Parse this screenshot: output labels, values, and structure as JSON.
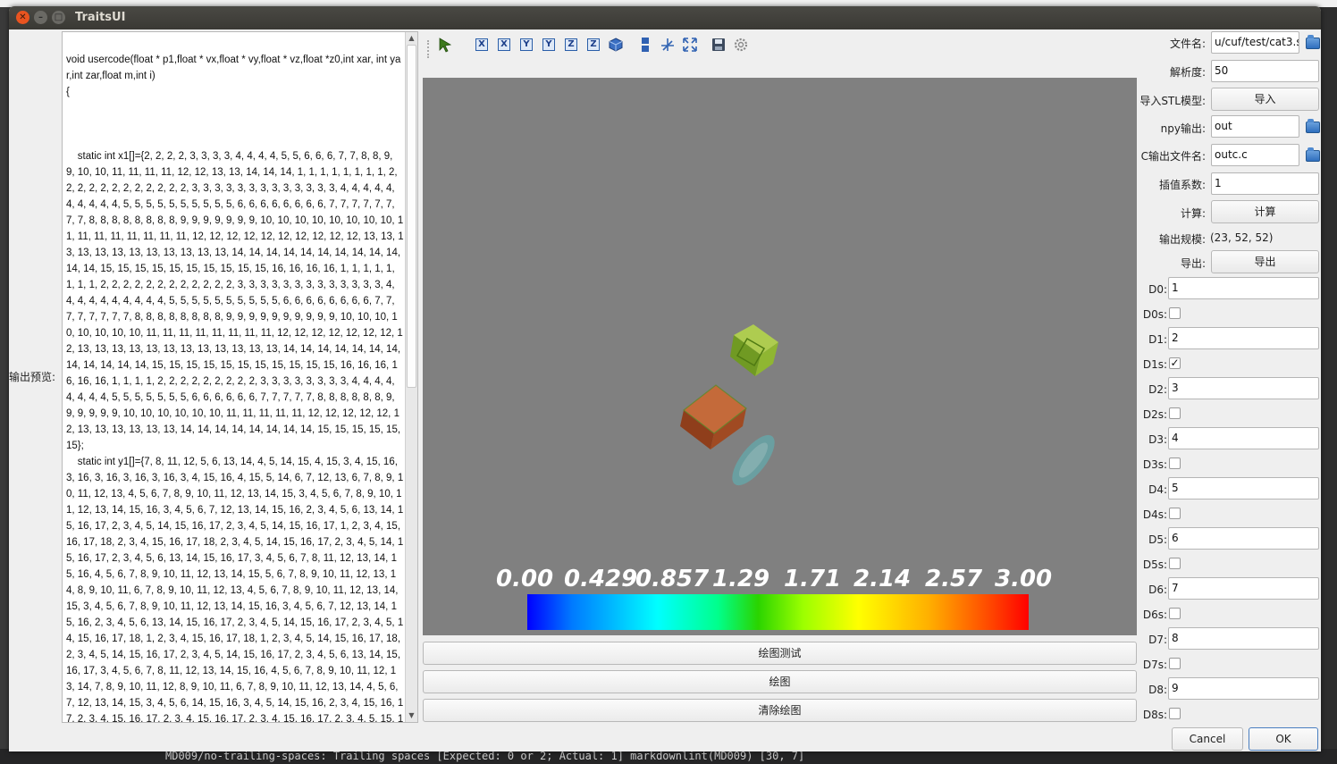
{
  "window": {
    "title": "TraitsUI"
  },
  "background": {
    "status_text": "MD009/no-trailing-spaces: Trailing spaces [Expected: 0 or 2; Actual: 1]  markdownlint(MD009)  [30, 7]"
  },
  "left": {
    "preview_label": "输出预览:",
    "code": "void usercode(float * p1,float * vx,float * vy,float * vz,float *z0,int xar, int yar,int zar,float m,int i)\n{\n\n\n\n    static int x1[]={2, 2, 2, 2, 3, 3, 3, 3, 4, 4, 4, 4, 5, 5, 6, 6, 6, 7, 7, 8, 8, 9, 9, 10, 10, 11, 11, 11, 11, 12, 12, 13, 13, 14, 14, 14, 1, 1, 1, 1, 1, 1, 1, 1, 2, 2, 2, 2, 2, 2, 2, 2, 2, 2, 2, 2, 3, 3, 3, 3, 3, 3, 3, 3, 3, 3, 3, 3, 3, 4, 4, 4, 4, 4, 4, 4, 4, 4, 4, 5, 5, 5, 5, 5, 5, 5, 5, 5, 5, 6, 6, 6, 6, 6, 6, 6, 6, 7, 7, 7, 7, 7, 7, 7, 7, 8, 8, 8, 8, 8, 8, 8, 8, 9, 9, 9, 9, 9, 9, 9, 10, 10, 10, 10, 10, 10, 10, 10, 11, 11, 11, 11, 11, 11, 11, 11, 12, 12, 12, 12, 12, 12, 12, 12, 12, 12, 13, 13, 13, 13, 13, 13, 13, 13, 13, 13, 13, 13, 14, 14, 14, 14, 14, 14, 14, 14, 14, 14, 14, 14, 15, 15, 15, 15, 15, 15, 15, 15, 15, 15, 16, 16, 16, 16, 1, 1, 1, 1, 1, 1, 1, 1, 2, 2, 2, 2, 2, 2, 2, 2, 2, 2, 2, 2, 3, 3, 3, 3, 3, 3, 3, 3, 3, 3, 3, 3, 3, 4, 4, 4, 4, 4, 4, 4, 4, 4, 4, 5, 5, 5, 5, 5, 5, 5, 5, 5, 5, 6, 6, 6, 6, 6, 6, 6, 6, 7, 7, 7, 7, 7, 7, 7, 7, 8, 8, 8, 8, 8, 8, 8, 8, 9, 9, 9, 9, 9, 9, 9, 9, 9, 9, 10, 10, 10, 10, 10, 10, 10, 10, 11, 11, 11, 11, 11, 11, 11, 11, 12, 12, 12, 12, 12, 12, 12, 12, 13, 13, 13, 13, 13, 13, 13, 13, 13, 13, 13, 13, 14, 14, 14, 14, 14, 14, 14, 14, 14, 14, 14, 14, 15, 15, 15, 15, 15, 15, 15, 15, 15, 15, 15, 16, 16, 16, 16, 16, 16, 1, 1, 1, 1, 2, 2, 2, 2, 2, 2, 2, 2, 2, 3, 3, 3, 3, 3, 3, 3, 3, 4, 4, 4, 4, 4, 4, 4, 4, 5, 5, 5, 5, 5, 5, 5, 6, 6, 6, 6, 6, 6, 7, 7, 7, 7, 7, 8, 8, 8, 8, 8, 8, 9, 9, 9, 9, 9, 9, 10, 10, 10, 10, 10, 10, 11, 11, 11, 11, 11, 12, 12, 12, 12, 12, 12, 13, 13, 13, 13, 13, 13, 14, 14, 14, 14, 14, 14, 14, 14, 15, 15, 15, 15, 15, 15};\n    static int y1[]={7, 8, 11, 12, 5, 6, 13, 14, 4, 5, 14, 15, 4, 15, 3, 4, 15, 16, 3, 16, 3, 16, 3, 16, 3, 16, 3, 4, 15, 16, 4, 15, 5, 14, 6, 7, 12, 13, 6, 7, 8, 9, 10, 11, 12, 13, 4, 5, 6, 7, 8, 9, 10, 11, 12, 13, 14, 15, 3, 4, 5, 6, 7, 8, 9, 10, 11, 12, 13, 14, 15, 16, 3, 4, 5, 6, 7, 12, 13, 14, 15, 16, 2, 3, 4, 5, 6, 13, 14, 15, 16, 17, 2, 3, 4, 5, 14, 15, 16, 17, 2, 3, 4, 5, 14, 15, 16, 17, 1, 2, 3, 4, 15, 16, 17, 18, 2, 3, 4, 15, 16, 17, 18, 2, 3, 4, 5, 14, 15, 16, 17, 2, 3, 4, 5, 14, 15, 16, 17, 2, 3, 4, 5, 6, 13, 14, 15, 16, 17, 3, 4, 5, 6, 7, 8, 11, 12, 13, 14, 15, 16, 4, 5, 6, 7, 8, 9, 10, 11, 12, 13, 14, 15, 5, 6, 7, 8, 9, 10, 11, 12, 13, 14, 8, 9, 10, 11, 6, 7, 8, 9, 10, 11, 12, 13, 4, 5, 6, 7, 8, 9, 10, 11, 12, 13, 14, 15, 3, 4, 5, 6, 7, 8, 9, 10, 11, 12, 13, 14, 15, 16, 3, 4, 5, 6, 7, 12, 13, 14, 15, 16, 2, 3, 4, 5, 6, 13, 14, 15, 16, 17, 2, 3, 4, 5, 14, 15, 16, 17, 2, 3, 4, 5, 14, 15, 16, 17, 18, 1, 2, 3, 4, 15, 16, 17, 18, 1, 2, 3, 4, 5, 14, 15, 16, 17, 18, 2, 3, 4, 5, 14, 15, 16, 17, 2, 3, 4, 5, 14, 15, 16, 17, 2, 3, 4, 5, 6, 13, 14, 15, 16, 17, 3, 4, 5, 6, 7, 8, 11, 12, 13, 14, 15, 16, 4, 5, 6, 7, 8, 9, 10, 11, 12, 13, 14, 7, 8, 9, 10, 11, 12, 8, 9, 10, 11, 6, 7, 8, 9, 10, 11, 12, 13, 14, 4, 5, 6, 7, 12, 13, 14, 15, 3, 4, 5, 6, 14, 15, 16, 3, 4, 5, 14, 15, 16, 2, 3, 4, 15, 16, 17, 2, 3, 4, 15, 16, 17, 2, 3, 4, 15, 16, 17, 2, 3, 4, 15, 16, 17, 2, 3, 4, 5, 15, 16,"
  },
  "toolbar": {
    "icons": [
      "select-icon",
      "view-x-plus-icon",
      "view-x-minus-icon",
      "view-y-plus-icon",
      "view-y-minus-icon",
      "view-z-plus-icon",
      "view-z-minus-icon",
      "isometric-view-icon",
      "parallel-projection-icon",
      "axes-icon",
      "fullscreen-icon",
      "save-icon",
      "settings-icon"
    ],
    "axis_letters": [
      "X",
      "X",
      "Y",
      "Y",
      "Z",
      "Z"
    ]
  },
  "colorbar": {
    "labels": [
      "0.00",
      "0.429",
      "0.857",
      "1.29",
      "1.71",
      "2.14",
      "2.57",
      "3.00"
    ],
    "min": 0.0,
    "max": 3.0
  },
  "buttons": {
    "test_plot": "绘图测试",
    "plot": "绘图",
    "clear_plot": "清除绘图"
  },
  "form": {
    "filename_label": "文件名:",
    "filename_value": "u/cuf/test/cat3.stl",
    "resolution_label": "解析度:",
    "resolution_value": "50",
    "import_label": "导入STL模型:",
    "import_button": "导入",
    "npy_label": "npy输出:",
    "npy_value": "out",
    "cfile_label": "C输出文件名:",
    "cfile_value": "outc.c",
    "interp_label": "插值系数:",
    "interp_value": "1",
    "compute_label": "计算:",
    "compute_button": "计算",
    "scale_label": "输出规模:",
    "scale_value": "(23, 52, 52)",
    "export_label": "导出:",
    "export_button": "导出",
    "d_rows": [
      {
        "label": "D0:",
        "value": "1",
        "check_label": "D0s:",
        "checked": false
      },
      {
        "label": "D1:",
        "value": "2",
        "check_label": "D1s:",
        "checked": true
      },
      {
        "label": "D2:",
        "value": "3",
        "check_label": "D2s:",
        "checked": false
      },
      {
        "label": "D3:",
        "value": "4",
        "check_label": "D3s:",
        "checked": false
      },
      {
        "label": "D4:",
        "value": "5",
        "check_label": "D4s:",
        "checked": false
      },
      {
        "label": "D5:",
        "value": "6",
        "check_label": "D5s:",
        "checked": false
      },
      {
        "label": "D6:",
        "value": "7",
        "check_label": "D6s:",
        "checked": false
      },
      {
        "label": "D7:",
        "value": "8",
        "check_label": "D7s:",
        "checked": false
      },
      {
        "label": "D8:",
        "value": "9",
        "check_label": "D8s:",
        "checked": false
      }
    ]
  },
  "dialog": {
    "cancel": "Cancel",
    "ok": "OK"
  }
}
